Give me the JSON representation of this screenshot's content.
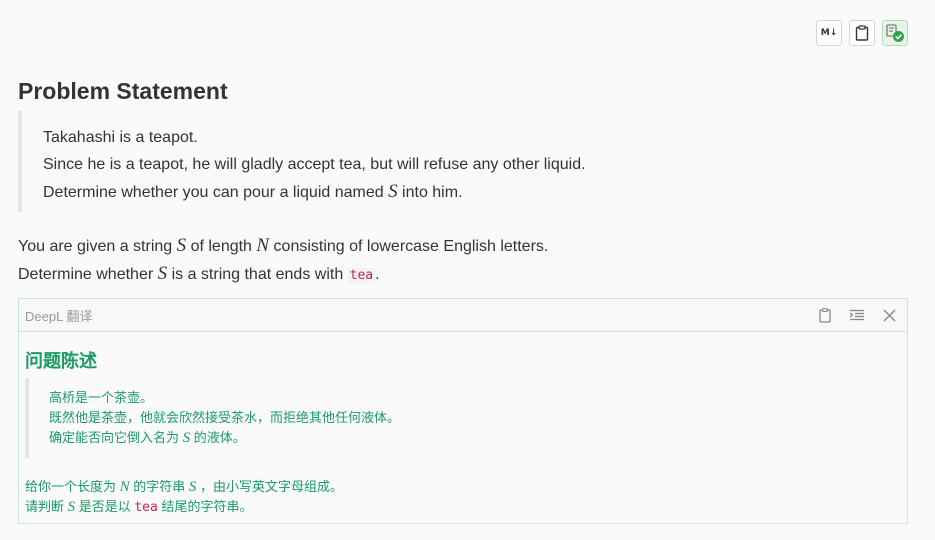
{
  "toolbar": {
    "markdown_label": "M↓"
  },
  "problem": {
    "title": "Problem Statement",
    "quote_lines": [
      "Takahashi is a teapot.",
      "Since he is a teapot, he will gladly accept tea, but will refuse any other liquid.",
      [
        "Determine whether you can pour a liquid named ",
        "S",
        " into him."
      ]
    ],
    "para": {
      "l1a": "You are given a string ",
      "l1v1": "S",
      "l1b": " of length ",
      "l1v2": "N",
      "l1c": " consisting of lowercase English letters.",
      "l2a": "Determine whether ",
      "l2v": "S",
      "l2b": " is a string that ends with ",
      "l2code": "tea",
      "l2c": "."
    }
  },
  "deepl": {
    "header": "DeepL 翻译",
    "title": "问题陈述",
    "q1": "高桥是一个茶壶。",
    "q2": "既然他是茶壶，他就会欣然接受茶水，而拒绝其他任何液体。",
    "q3a": "确定能否向它倒入名为 ",
    "q3v": "S",
    "q3b": " 的液体。",
    "p1a": "给你一个长度为 ",
    "p1v1": "N",
    "p1b": " 的字符串 ",
    "p1v2": "S",
    "p1c": " ，由小写英文字母组成。",
    "p2a": "请判断 ",
    "p2v": "S",
    "p2b": " 是否是以 ",
    "p2code": "tea",
    "p2c": " 结尾的字符串。"
  }
}
